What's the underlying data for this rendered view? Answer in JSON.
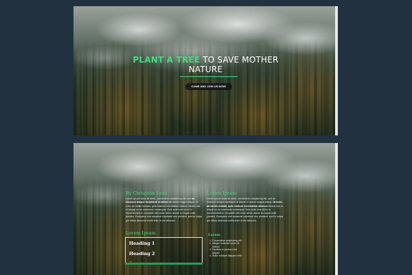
{
  "hero": {
    "title_accent": "PLANT A TREE",
    "title_rest": " TO SAVE MOTHER",
    "title_line2": "NATURE",
    "cta_label": "COME AND JOIN US NOW!"
  },
  "section": {
    "left_title": "By Chrisjohn Laxa",
    "right_title": "Lorem Ipsum",
    "left_para_1": "Lorem ipsum dolor sit amet, consectetur adipisicing elit, sed",
    "left_para_bold": "do eiusmod tempor incididunt ut labore et",
    "left_para_2": "dolore magna aliqua. Ut enim ad minim veniam, quis nostrud exercitation ullamco laboris nisi ut aliquip ex ea commodo consequat. Duis aute irure dolor in reprehenderit in voluptate velit esse cillum dolore eu fugiat nulla pariatur. Excepteur sint occaecat cupidatat non proident, sunt in culpa qui officia deserunt mollit anim id est laborum.",
    "right_para_1": "Lorem ipsum dolor sit amet, consectetur adipisicing elit, sed do eiusmod tempor incididunt ut labore et dolore magna aliqua.",
    "right_para_bold": "Ut enim ad minim veniam, quis nostrud exercitation ullamco",
    "right_para_2": "laboris nisi ut aliquip ex ea commodo consequat. Duis aute irure dolor in reprehenderit in voluptate velit esse cillum dolore eu fugiat nulla pariatur. Excepteur sint occaecat cupidatat non proident, sunt in culpa qui officia deserunt mollit anim id est laborum.",
    "box_title": "Lorem Ipsum",
    "heading_1": "Heading 1",
    "heading_2": "Heading 2",
    "box_more": "...",
    "list_title": "Lorem",
    "list_items": [
      "Consectetur adipisicing elit",
      "Integer molestie lorem at massa",
      "Facilisis in pretium nisl aliquet",
      "Nulla volutpat aliquam velit"
    ]
  },
  "colors": {
    "accent": "#45d97f",
    "background": "#213140",
    "box_bar": "#2e9a5c"
  }
}
